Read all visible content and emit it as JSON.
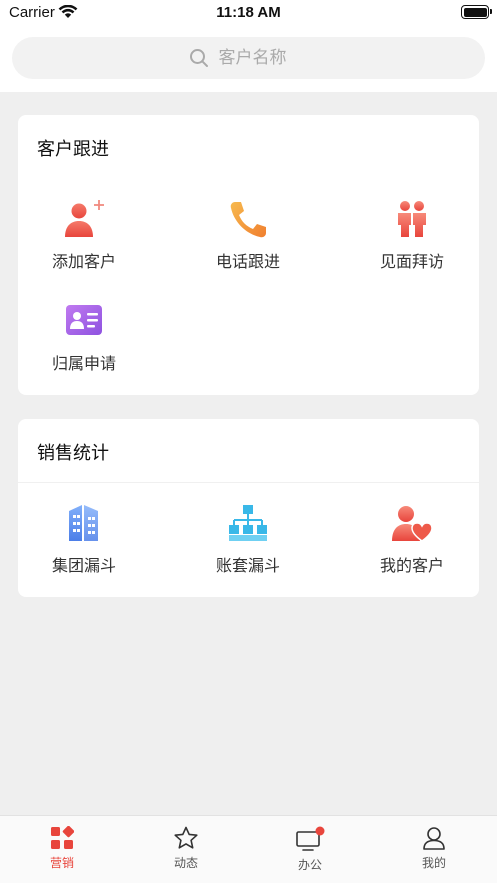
{
  "status_bar": {
    "carrier": "Carrier",
    "time": "11:18 AM"
  },
  "search": {
    "placeholder": "客户名称"
  },
  "follow_up": {
    "title": "客户跟进",
    "items": [
      {
        "label": "添加客户",
        "icon": "add-customer-icon"
      },
      {
        "label": "电话跟进",
        "icon": "phone-icon"
      },
      {
        "label": "见面拜访",
        "icon": "visit-icon"
      },
      {
        "label": "归属申请",
        "icon": "id-card-icon"
      }
    ]
  },
  "sales_stats": {
    "title": "销售统计",
    "items": [
      {
        "label": "集团漏斗",
        "icon": "building-icon"
      },
      {
        "label": "账套漏斗",
        "icon": "org-chart-icon"
      },
      {
        "label": "我的客户",
        "icon": "my-customer-icon"
      }
    ]
  },
  "tabs": [
    {
      "label": "营销",
      "icon": "grid-icon",
      "active": true
    },
    {
      "label": "动态",
      "icon": "star-icon",
      "active": false
    },
    {
      "label": "办公",
      "icon": "monitor-icon",
      "active": false
    },
    {
      "label": "我的",
      "icon": "user-icon",
      "active": false
    }
  ],
  "colors": {
    "accent": "#e8453c",
    "orange": "#f39a3c",
    "purple": "#a466e6",
    "blue": "#5b8ef0",
    "cyan": "#39b8e8"
  }
}
